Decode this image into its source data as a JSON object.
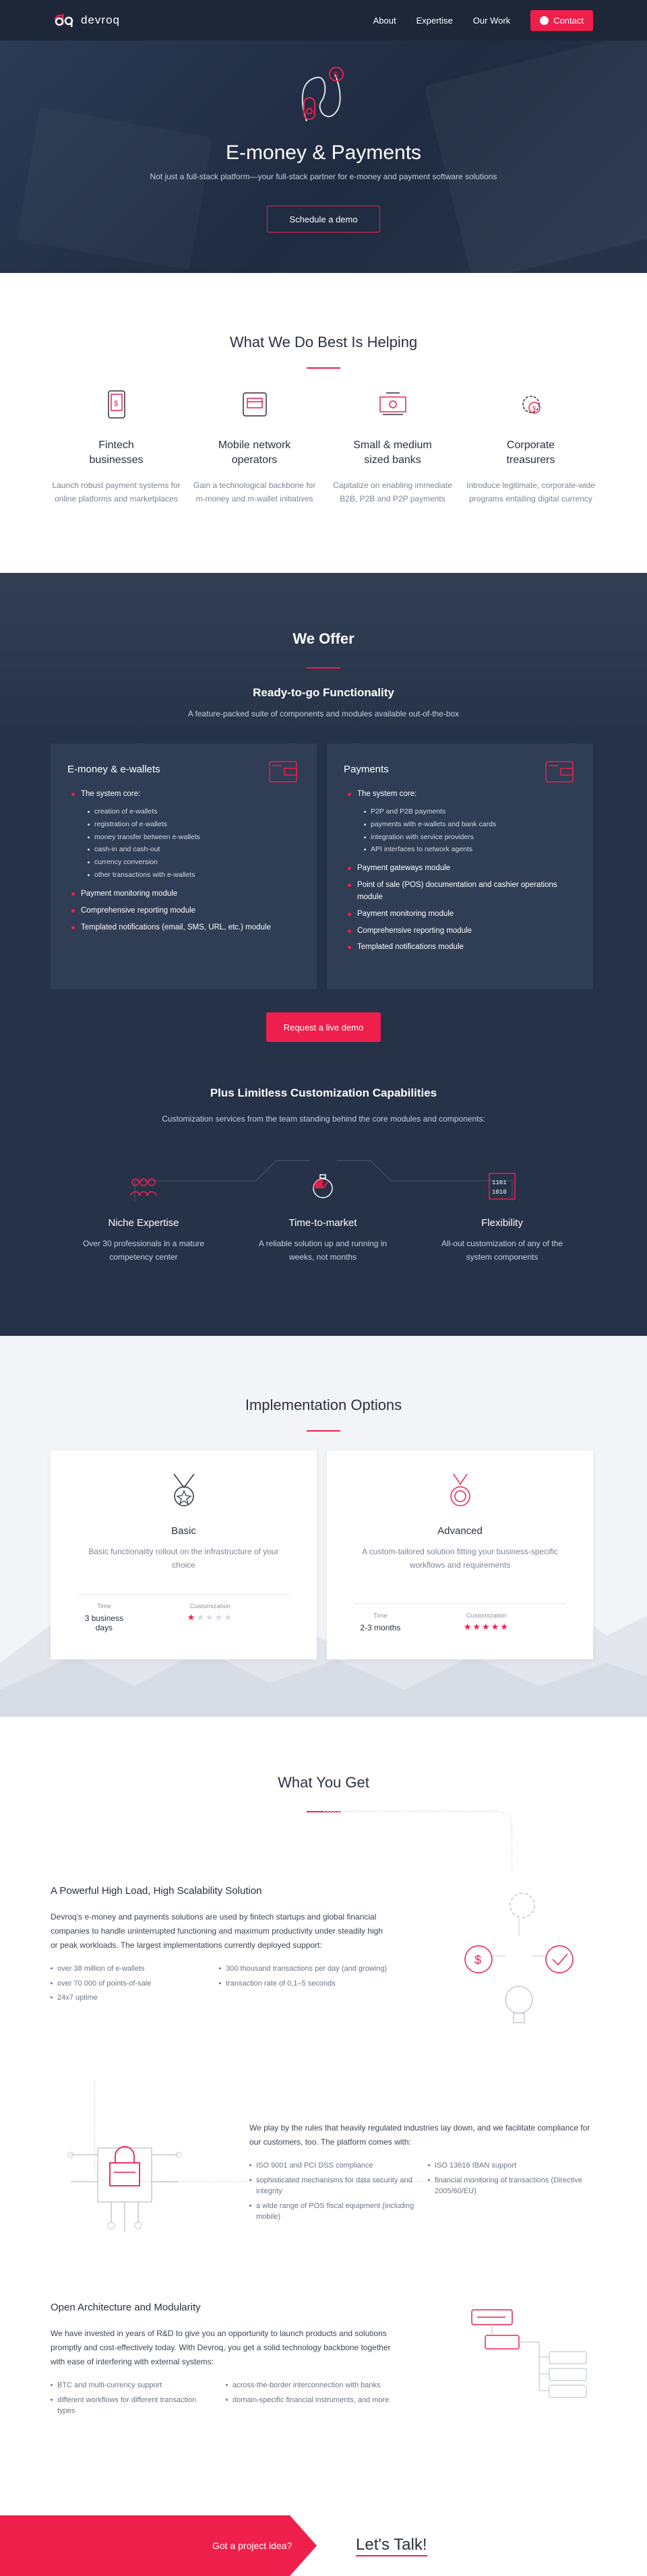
{
  "header": {
    "logo_text": "devroq",
    "nav": [
      "About",
      "Expertise",
      "Our Work"
    ],
    "contact_label": "Contact"
  },
  "hero": {
    "title": "E-money & Payments",
    "subtitle": "Not just a full-stack platform—your full-stack partner for e-money and payment software solutions",
    "cta": "Schedule a demo"
  },
  "whatwedo": {
    "title": "What We Do Best Is Helping",
    "items": [
      {
        "title": "Fintech\nbusinesses",
        "desc": "Launch robust payment systems for online platforms and marketplaces",
        "icon": "phone-payment-icon"
      },
      {
        "title": "Mobile network\noperators",
        "desc": "Gain a technological backbone for m-money and m-wallet initiatives",
        "icon": "mobile-card-icon"
      },
      {
        "title": "Small & medium\nsized banks",
        "desc": "Capitalize on enabling immediate B2B, P2B and P2P payments",
        "icon": "bank-cash-icon"
      },
      {
        "title": "Corporate\ntreasurers",
        "desc": "Introduce legitimate, corporate-wide programs entailing digital currency",
        "icon": "gear-money-icon"
      }
    ]
  },
  "offer": {
    "title": "We Offer",
    "subtitle": "Ready-to-go Functionality",
    "desc": "A feature-packed suite of components and modules available out-of-the-box",
    "cards": [
      {
        "title": "E-money & e-wallets",
        "core": "The system core:",
        "core_items": [
          "creation of e-wallets",
          "registration of e-wallets",
          "money transfer between e-wallets",
          "cash-in and cash-out",
          "currency conversion",
          "other transactions with e-wallets"
        ],
        "modules": [
          "Payment monitoring module",
          "Comprehensive reporting module",
          "Templated notifications (email, SMS, URL, etc.) module"
        ]
      },
      {
        "title": "Payments",
        "core": "The system core:",
        "core_items": [
          "P2P and P2B payments",
          "payments with e-wallets and bank cards",
          "integration with service providers",
          "API interfaces to network agents"
        ],
        "modules": [
          "Payment gateways module",
          "Point of sale (POS) documentation and cashier operations module",
          "Payment monitoring module",
          "Comprehensive reporting module",
          "Templated notifications module"
        ]
      }
    ],
    "cta": "Request a live demo",
    "custom_title": "Plus Limitless Customization Capabilities",
    "custom_desc": "Customization services from the team standing behind the core modules and components:",
    "features": [
      {
        "title": "Niche Expertise",
        "desc": "Over 30 professionals in a mature competency center",
        "icon": "team-icon"
      },
      {
        "title": "Time-to-market",
        "desc": "A reliable solution up and running in weeks, not months",
        "icon": "stopwatch-icon"
      },
      {
        "title": "Flexibility",
        "desc": "All-out customization of any of the system components",
        "icon": "binary-code-icon"
      }
    ]
  },
  "implementation": {
    "title": "Implementation Options",
    "options": [
      {
        "title": "Basic",
        "desc": "Basic functionality rollout on the infrastructure of your choice",
        "time_label": "Time",
        "time": "3 business days",
        "custom_label": "Customization",
        "rating": 1,
        "icon": "medal-icon"
      },
      {
        "title": "Advanced",
        "desc": "A custom-tailored solution fitting your business-specific workflows and requirements",
        "time_label": "Time",
        "time": "2-3 months",
        "custom_label": "Customization",
        "rating": 5,
        "icon": "award-icon"
      }
    ]
  },
  "get": {
    "title": "What You Get",
    "blocks": [
      {
        "title": "A Powerful High Load, High Scalability Solution",
        "text": "Devroq’s e-money and payments solutions are used by fintech startups and global financial companies to handle uninterrupted functioning and maximum productivity under steadily high or peak workloads. The largest implementations currently deployed support:",
        "list_left": [
          "over 38 million of e-wallets",
          "over 70 000 of points-of-sale",
          "24x7 uptime"
        ],
        "list_right": [
          "300 thousand transactions per day (and growing)",
          "transaction rate of 0,1–5 seconds"
        ]
      },
      {
        "title": "",
        "text": "We play by the rules that heavily regulated industries lay down, and we facilitate compliance for our customers, too. The platform comes with:",
        "list_left": [
          "ISO 9001 and PCI DSS compliance",
          "sophisticated mechanisms for data security and integrity",
          "a wide range of POS fiscal equipment (including mobile)"
        ],
        "list_right": [
          "ISO 13616 IBAN support",
          "financial monitoring of transactions (Directive 2005/60/EU)"
        ]
      },
      {
        "title": "Open Architecture and Modularity",
        "text": "We have invested in years of R&D to give you an opportunity to launch products and solutions promptly and cost-effectively today. With Devroq, you get a solid technology backbone together with ease of interfering with external systems:",
        "list_left": [
          "BTC and multi-currency support",
          "different workflows for different transaction types"
        ],
        "list_right": [
          "across-the-border interconnection with banks",
          "domain-specific financial instruments, and more"
        ]
      }
    ]
  },
  "cta": {
    "question": "Got a project idea?",
    "talk": "Let's Talk!"
  },
  "colors": {
    "accent": "#ef1f4b",
    "navy": "#253248",
    "header": "#1d2738"
  }
}
